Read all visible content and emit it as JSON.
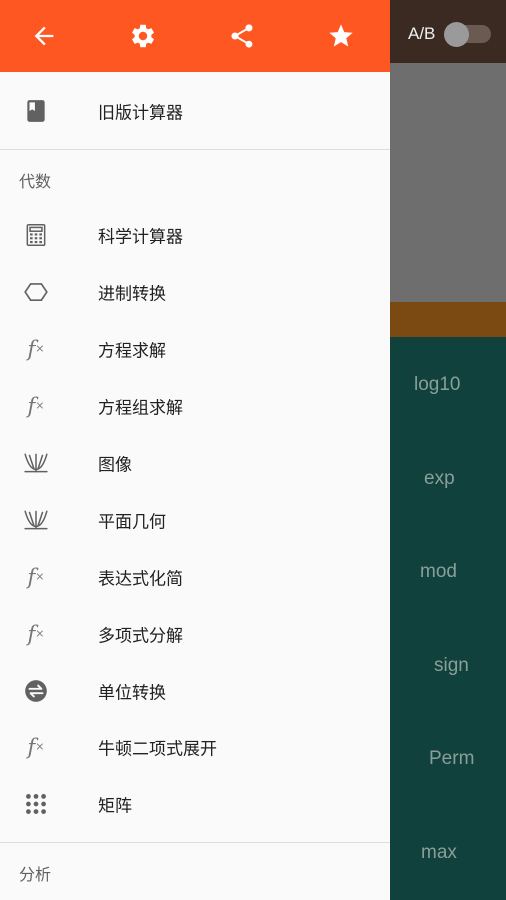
{
  "background": {
    "ab_label": "A/B",
    "toggle_on": false,
    "keys": [
      "log10",
      "exp",
      "mod",
      "sign",
      "Perm",
      "max"
    ]
  },
  "colors": {
    "accent": "#ff5722",
    "drawer_bg": "#fafafa",
    "keypad_bg": "#11413c",
    "display_bg": "#6e6e6e"
  },
  "drawer": {
    "header_icons": [
      "arrow-back-icon",
      "gear-icon",
      "share-icon",
      "star-icon"
    ],
    "top_item": {
      "label": "旧版计算器",
      "icon": "book-icon"
    },
    "section_algebra": "代数",
    "items": [
      {
        "label": "科学计算器",
        "icon": "calculator-icon"
      },
      {
        "label": "进制转换",
        "icon": "hexagon-icon"
      },
      {
        "label": "方程求解",
        "icon": "fx-icon"
      },
      {
        "label": "方程组求解",
        "icon": "fx-icon"
      },
      {
        "label": "图像",
        "icon": "graph-icon"
      },
      {
        "label": "平面几何",
        "icon": "graph-icon"
      },
      {
        "label": "表达式化简",
        "icon": "fx-icon"
      },
      {
        "label": "多项式分解",
        "icon": "fx-icon"
      },
      {
        "label": "单位转换",
        "icon": "swap-icon"
      },
      {
        "label": "牛顿二项式展开",
        "icon": "fx-icon"
      },
      {
        "label": "矩阵",
        "icon": "grid-icon"
      }
    ],
    "section_analysis": "分析"
  }
}
